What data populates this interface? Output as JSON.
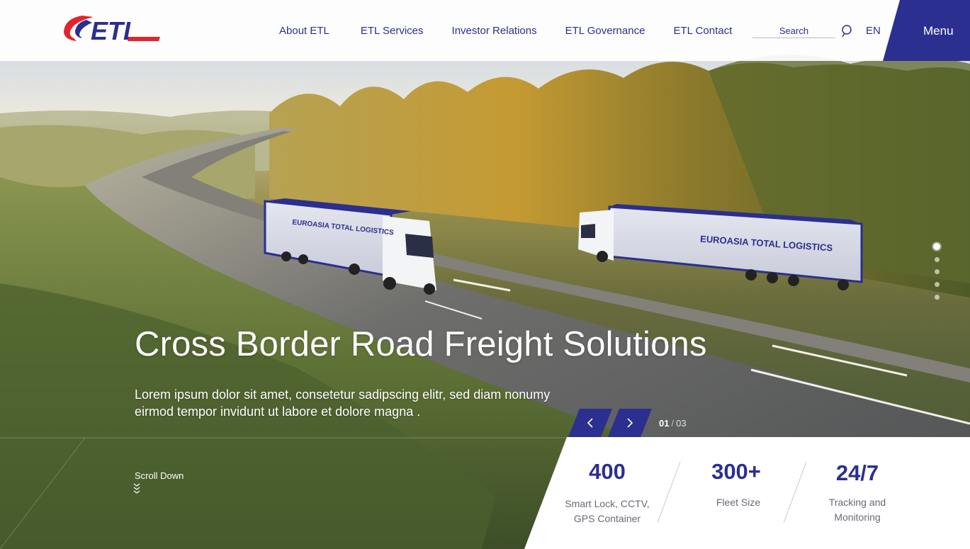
{
  "brand": {
    "logo_text": "ETL",
    "accent": "#2b2f8f",
    "red": "#e3232d"
  },
  "nav": {
    "items": [
      {
        "label": "About ETL"
      },
      {
        "label": "ETL Services"
      },
      {
        "label": "Investor Relations"
      },
      {
        "label": "ETL Governance"
      },
      {
        "label": "ETL Contact"
      }
    ],
    "search_placeholder": "Search",
    "search_icon": "search-icon",
    "language": "EN",
    "menu_label": "Menu"
  },
  "hero": {
    "title": "Cross Border Road Freight Solutions",
    "subtitle": "Lorem ipsum dolor sit amet, consetetur sadipscing elitr, sed diam nonumy eirmod tempor invidunt ut labore et dolore magna .",
    "truck_text": "EUROASIA TOTAL LOGISTICS",
    "scroll_label": "Scroll Down",
    "slide_current": "01",
    "slide_separator": "/",
    "slide_total": "03"
  },
  "stats": [
    {
      "value": "400",
      "label_line1": "Smart Lock, CCTV,",
      "label_line2": "GPS Container"
    },
    {
      "value": "300+",
      "label_line1": "Fleet Size",
      "label_line2": ""
    },
    {
      "value": "24/7",
      "label_line1": "Tracking and",
      "label_line2": "Monitoring"
    }
  ]
}
